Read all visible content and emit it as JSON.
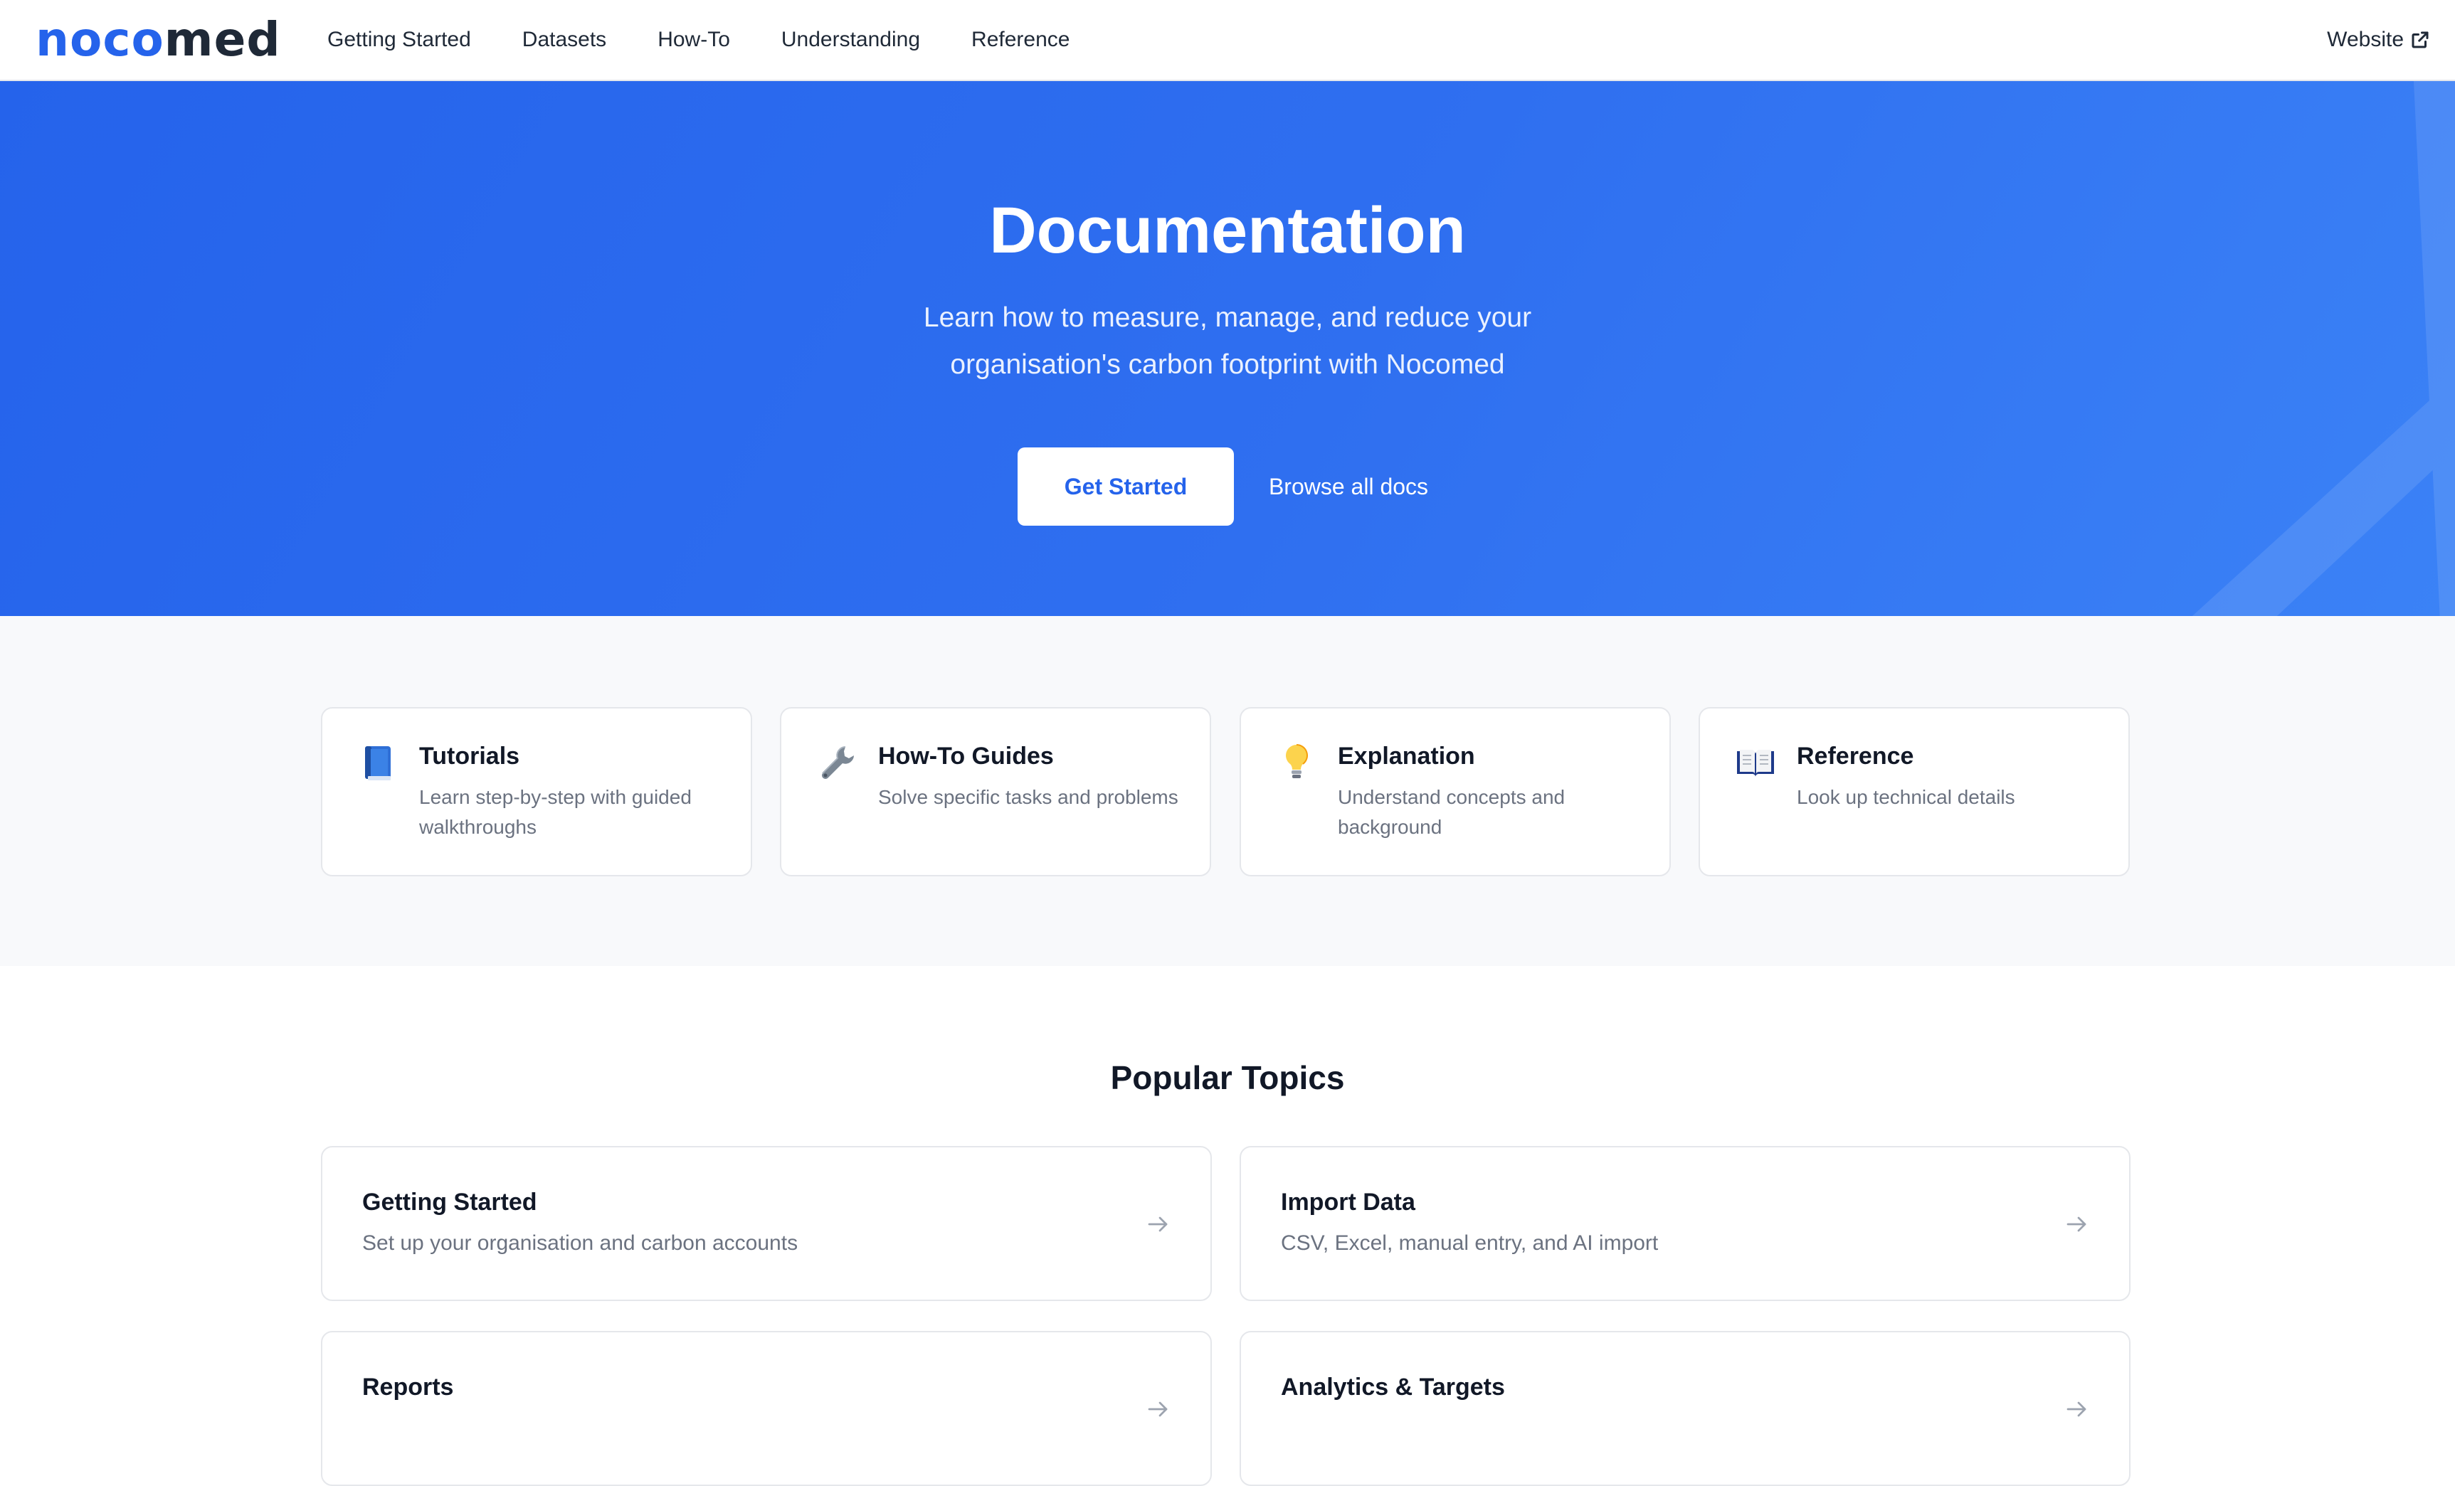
{
  "nav": {
    "logo_part1": "noco",
    "logo_part2": "med",
    "links": [
      "Getting Started",
      "Datasets",
      "How-To",
      "Understanding",
      "Reference"
    ],
    "website_label": "Website",
    "website_icon": "external-link-icon"
  },
  "hero": {
    "title": "Documentation",
    "subtitle": "Learn how to measure, manage, and reduce your organisation's carbon footprint with Nocomed",
    "primary_button": "Get Started",
    "secondary_button": "Browse all docs"
  },
  "categories": [
    {
      "title": "Tutorials",
      "description": "Learn step-by-step with guided walkthroughs",
      "icon": "blue-book-icon"
    },
    {
      "title": "How-To Guides",
      "description": "Solve specific tasks and problems",
      "icon": "wrench-icon"
    },
    {
      "title": "Explanation",
      "description": "Understand concepts and background",
      "icon": "lightbulb-icon"
    },
    {
      "title": "Reference",
      "description": "Look up technical details",
      "icon": "open-book-icon"
    }
  ],
  "popular": {
    "title": "Popular Topics",
    "topics": [
      {
        "title": "Getting Started",
        "description": "Set up your organisation and carbon accounts"
      },
      {
        "title": "Import Data",
        "description": "CSV, Excel, manual entry, and AI import"
      },
      {
        "title": "Reports",
        "description": ""
      },
      {
        "title": "Analytics & Targets",
        "description": ""
      }
    ]
  },
  "colors": {
    "brand_blue": "#2563eb",
    "text_dark": "#111827",
    "text_muted": "#6b7280",
    "border": "#e5e7eb",
    "band_bg": "#f8f9fb"
  }
}
